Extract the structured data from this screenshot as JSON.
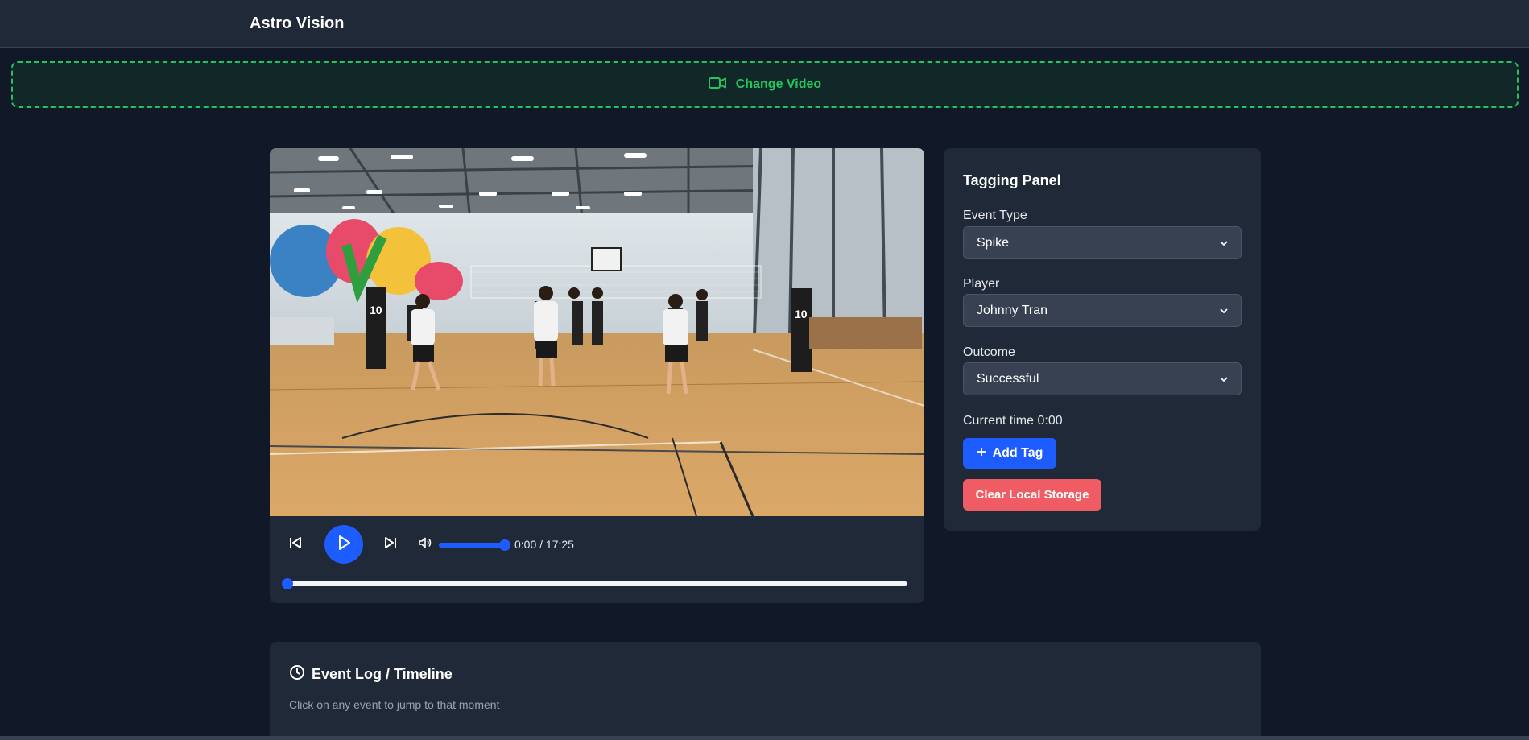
{
  "header": {
    "app_title": "Astro Vision"
  },
  "upload": {
    "change_video_label": "Change Video",
    "accent_color": "#22c55e"
  },
  "player": {
    "time_readout": "0:00 / 17:25",
    "volume_level": 1.0,
    "progress_level": 0.0,
    "accent_color": "#1d5cff",
    "icons": [
      "skip-back-icon",
      "play-icon",
      "skip-forward-icon",
      "volume-icon"
    ]
  },
  "tagging_panel": {
    "title": "Tagging Panel",
    "event_type": {
      "label": "Event Type",
      "value": "Spike"
    },
    "player": {
      "label": "Player",
      "value": "Johnny Tran"
    },
    "outcome": {
      "label": "Outcome",
      "value": "Successful"
    },
    "current_time": "Current time 0:00",
    "add_tag_label": "Add Tag",
    "clear_storage_label": "Clear Local Storage",
    "clear_color": "#f05c64"
  },
  "event_log": {
    "title": "Event Log / Timeline",
    "subtitle": "Click on any event to jump to that moment"
  }
}
